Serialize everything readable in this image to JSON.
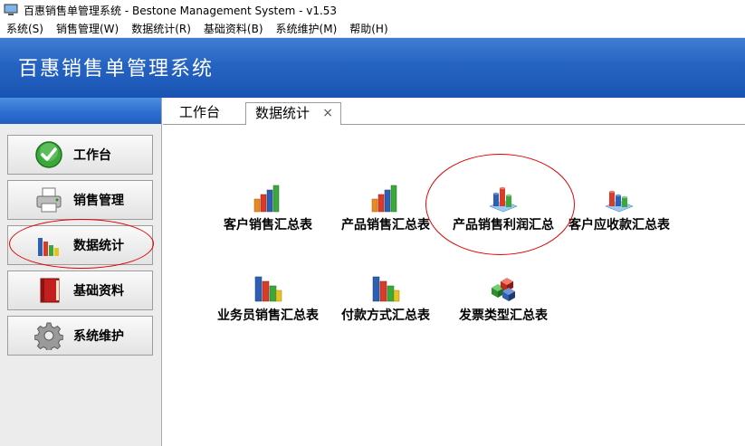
{
  "window": {
    "title": "百惠销售单管理系统 - Bestone Management System - v1.53"
  },
  "menu": {
    "items": [
      {
        "label": "系统(S)"
      },
      {
        "label": "销售管理(W)"
      },
      {
        "label": "数据统计(R)"
      },
      {
        "label": "基础资料(B)"
      },
      {
        "label": "系统维护(M)"
      },
      {
        "label": "帮助(H)"
      }
    ]
  },
  "banner": {
    "title": "百惠销售单管理系统"
  },
  "sidebar": {
    "items": [
      {
        "label": "工作台",
        "icon": "check-circle-icon"
      },
      {
        "label": "销售管理",
        "icon": "printer-icon"
      },
      {
        "label": "数据统计",
        "icon": "bar-chart-icon"
      },
      {
        "label": "基础资料",
        "icon": "book-icon"
      },
      {
        "label": "系统维护",
        "icon": "gear-icon"
      }
    ]
  },
  "tabs": {
    "items": [
      {
        "label": "工作台"
      },
      {
        "label": "数据统计",
        "close": "×"
      }
    ]
  },
  "reports": {
    "items": [
      {
        "label": "客户销售汇总表",
        "icon": "bar-chart-icon"
      },
      {
        "label": "产品销售汇总表",
        "icon": "bar-chart-icon"
      },
      {
        "label": "产品销售利润汇总",
        "icon": "cylinder-chart-icon"
      },
      {
        "label": "客户应收款汇总表",
        "icon": "cylinder-chart-icon"
      },
      {
        "label": "业务员销售汇总表",
        "icon": "column-chart-icon"
      },
      {
        "label": "付款方式汇总表",
        "icon": "column-chart-icon"
      },
      {
        "label": "发票类型汇总表",
        "icon": "cubes-icon"
      }
    ]
  },
  "colors": {
    "banner": "#2563c3",
    "annotation": "#e00000",
    "panel": "#ececec"
  }
}
